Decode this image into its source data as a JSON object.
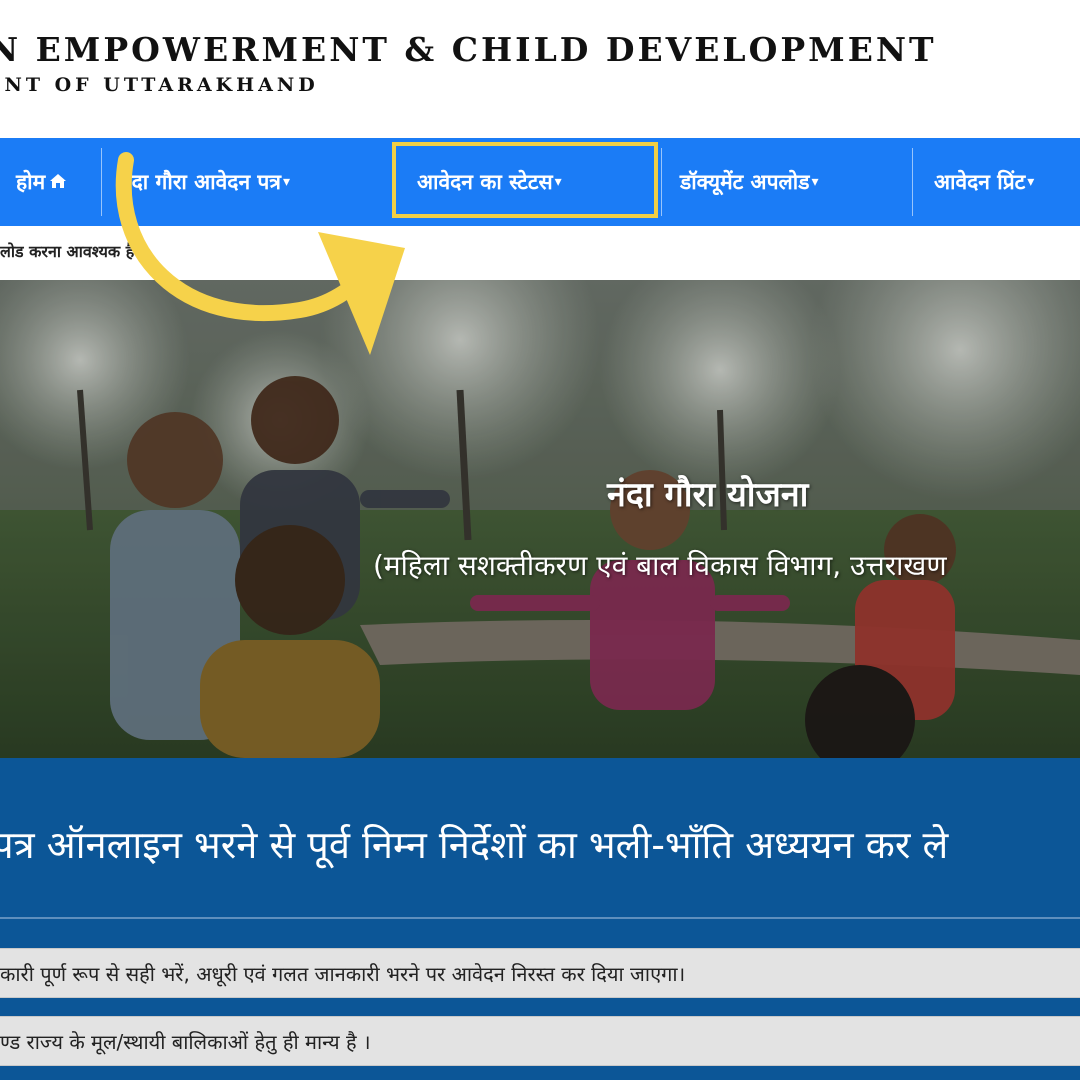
{
  "header": {
    "title": "n Empowerment & Child Development",
    "subtitle": "ent Of Uttarakhand"
  },
  "nav": {
    "items": [
      {
        "label": "होम",
        "icon": "home-icon"
      },
      {
        "label": "नंदा गौरा आवेदन पत्र"
      },
      {
        "label": "आवेदन का स्टेटस"
      },
      {
        "label": "डॉक्यूमेंट अपलोड"
      },
      {
        "label": "आवेदन प्रिंट"
      }
    ],
    "highlighted": "आवेदन का स्टेटस",
    "colors": {
      "bar": "#1b7cf6",
      "highlight": "#f2cf45"
    }
  },
  "notice": {
    "text": "लोड करना आवश्यक है।"
  },
  "hero": {
    "title": "नंदा गौरा योजना",
    "subtitle": "(महिला सशक्तीकरण एवं बाल विकास विभाग, उत्तराखण"
  },
  "instructions": {
    "heading": "पत्र ऑनलाइन भरने से पूर्व निम्न निर्देशों का भली-भाँति अध्ययन कर ले",
    "items": [
      "कारी पूर्ण रूप से सही भरें, अधूरी एवं गलत जानकारी भरने पर आवेदन निरस्त कर दिया जाएगा।",
      "ण्ड राज्य के मूल/स्थायी बालिकाओं हेतु ही मान्य है ।"
    ],
    "colors": {
      "panel": "#0c5697",
      "row": "#e3e3e3"
    }
  }
}
